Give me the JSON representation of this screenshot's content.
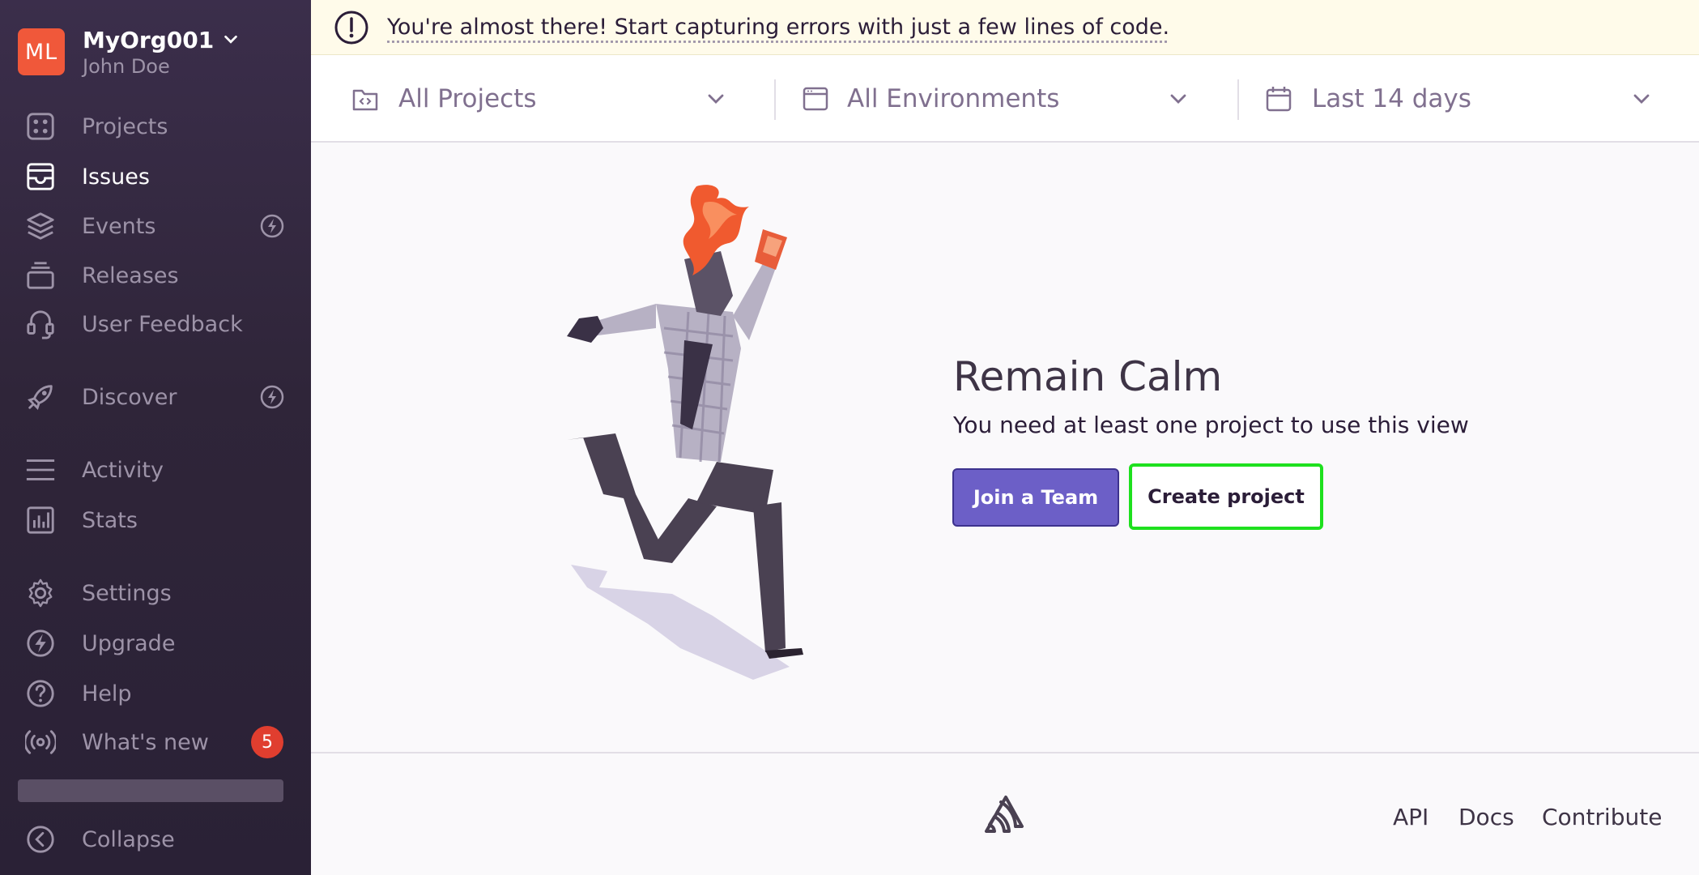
{
  "sidebar": {
    "org": {
      "initials": "ML",
      "name": "MyOrg001",
      "user": "John Doe"
    },
    "items": [
      {
        "label": "Projects",
        "icon": "projects-icon"
      },
      {
        "label": "Issues",
        "icon": "issues-icon",
        "active": true
      },
      {
        "label": "Events",
        "icon": "events-icon"
      },
      {
        "label": "Releases",
        "icon": "releases-icon"
      },
      {
        "label": "User Feedback",
        "icon": "user-feedback-icon"
      },
      {
        "label": "Discover",
        "icon": "discover-icon"
      },
      {
        "label": "Activity",
        "icon": "activity-icon"
      },
      {
        "label": "Stats",
        "icon": "stats-icon"
      },
      {
        "label": "Settings",
        "icon": "settings-icon"
      },
      {
        "label": "Upgrade",
        "icon": "upgrade-icon"
      },
      {
        "label": "Help",
        "icon": "help-icon"
      },
      {
        "label": "What's new",
        "icon": "broadcast-icon",
        "badge": "5"
      }
    ],
    "collapse_label": "Collapse"
  },
  "banner": {
    "text": "You're almost there! Start capturing errors with just a few lines of code."
  },
  "filters": {
    "projects": "All Projects",
    "environments": "All Environments",
    "date_range": "Last 14 days"
  },
  "empty_state": {
    "title": "Remain Calm",
    "subtitle": "You need at least one project to use this view",
    "primary_button": "Join a Team",
    "secondary_button": "Create project"
  },
  "footer": {
    "links": [
      "API",
      "Docs",
      "Contribute"
    ]
  },
  "colors": {
    "sidebar_bg": "#2f2539",
    "accent": "#6c5fc7",
    "avatar": "#f0583a",
    "badge": "#e03e2f",
    "highlight": "#1ee01e"
  }
}
